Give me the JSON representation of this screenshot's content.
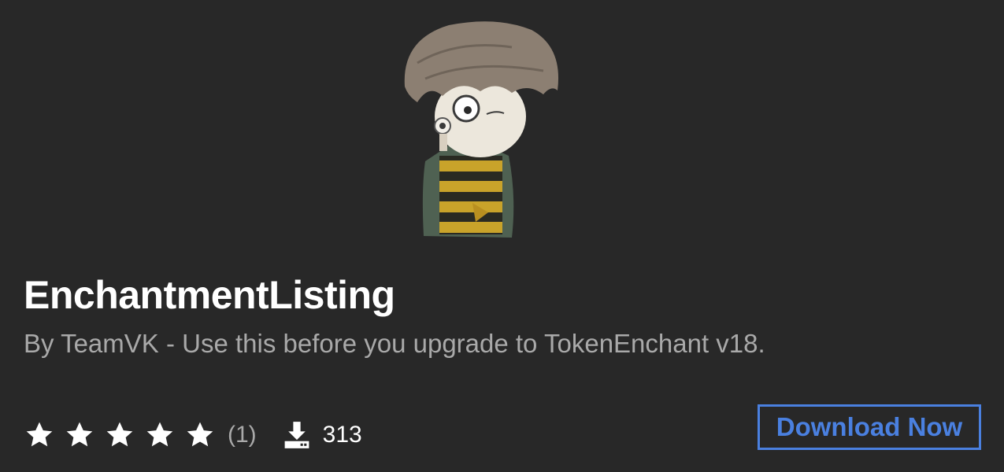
{
  "listing": {
    "title": "EnchantmentListing",
    "subtitle": "By TeamVK - Use this before you upgrade to TokenEnchant v18.",
    "image_icon": "character-portrait"
  },
  "stats": {
    "rating": 5,
    "rating_max": 5,
    "rating_count": "(1)",
    "downloads": "313",
    "star_icon": "star-icon",
    "download_icon": "download-icon"
  },
  "actions": {
    "download_label": "Download Now"
  },
  "colors": {
    "background": "#282828",
    "accent": "#4a80e0",
    "muted_text": "#a9a9a9"
  }
}
